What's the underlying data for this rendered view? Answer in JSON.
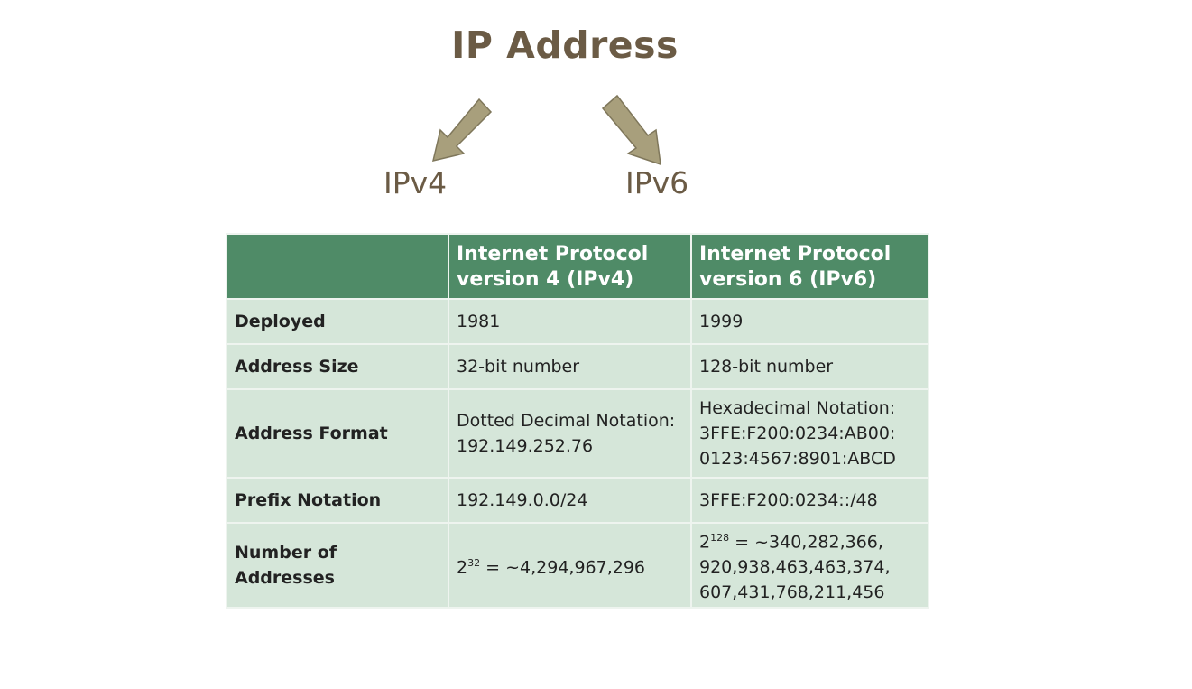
{
  "title": "IP Address",
  "branches": {
    "left": "IPv4",
    "right": "IPv6"
  },
  "colors": {
    "title": "#6b5b45",
    "arrow_fill": "#a89f7c",
    "header_bg": "#4f8b67",
    "cell_bg": "#d5e6d9"
  },
  "table": {
    "headers": [
      "",
      "Internet Protocol\nversion 4 (IPv4)",
      "Internet Protocol\nversion 6 (IPv6)"
    ],
    "rows": [
      {
        "label": "Deployed",
        "ipv4": "1981",
        "ipv6": "1999"
      },
      {
        "label": "Address Size",
        "ipv4": "32-bit number",
        "ipv6": "128-bit number"
      },
      {
        "label": "Address Format",
        "ipv4": "Dotted Decimal Notation:\n192.149.252.76",
        "ipv6": "Hexadecimal Notation:\n3FFE:F200:0234:AB00:\n0123:4567:8901:ABCD"
      },
      {
        "label": "Prefix Notation",
        "ipv4": "192.149.0.0/24",
        "ipv6": "3FFE:F200:0234::/48"
      },
      {
        "label": "Number of Addresses",
        "ipv4_base": "2",
        "ipv4_exp": "32",
        "ipv4_rest": " = ~4,294,967,296",
        "ipv6_base": "2",
        "ipv6_exp": "128",
        "ipv6_rest": " = ~340,282,366,\n920,938,463,463,374,\n607,431,768,211,456"
      }
    ]
  }
}
